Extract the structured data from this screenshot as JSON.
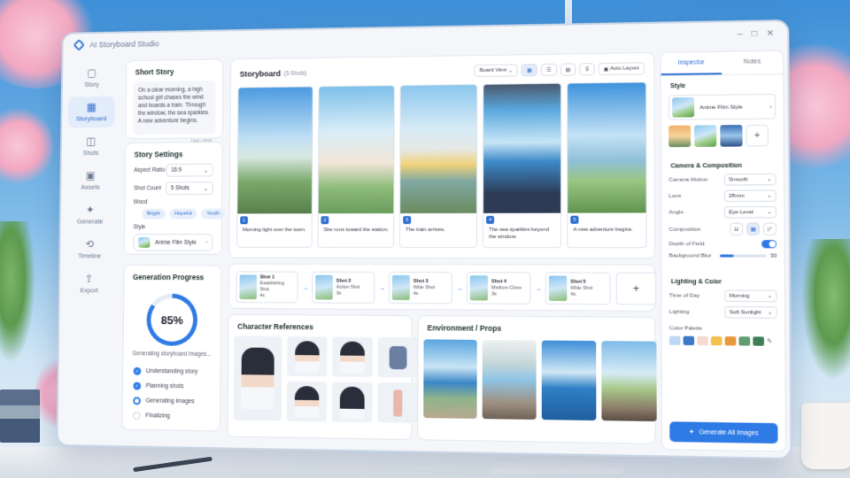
{
  "app": {
    "title": "AI Storyboard Studio"
  },
  "sidebar": {
    "items": [
      {
        "label": "Story",
        "icon": "book-icon"
      },
      {
        "label": "Storyboard",
        "icon": "grid-icon",
        "active": true
      },
      {
        "label": "Shots",
        "icon": "camera-icon"
      },
      {
        "label": "Assets",
        "icon": "image-icon"
      },
      {
        "label": "Generate",
        "icon": "sparkle-icon"
      },
      {
        "label": "Timeline",
        "icon": "timeline-icon"
      },
      {
        "label": "Export",
        "icon": "export-icon"
      }
    ]
  },
  "short_story": {
    "title": "Short Story",
    "text": "On a clear morning, a high school girl chases the wind and boards a train. Through the window, the sea sparkles. A new adventure begins.",
    "count": "184 / 500"
  },
  "settings": {
    "title": "Story Settings",
    "aspect_label": "Aspect Ratio",
    "aspect_value": "16:9",
    "shots_label": "Shot Count",
    "shots_value": "5 Shots",
    "mood_label": "Mood",
    "moods": [
      "Bright",
      "Hopeful",
      "Youth"
    ],
    "style_label": "Style",
    "style_value": "Anime Film Style"
  },
  "progress": {
    "title": "Generation Progress",
    "percent": 85,
    "percent_text": "85%",
    "status": "Generating storyboard images...",
    "steps": [
      {
        "label": "Understanding story",
        "state": "done"
      },
      {
        "label": "Planning shots",
        "state": "done"
      },
      {
        "label": "Generating images",
        "state": "active"
      },
      {
        "label": "Finalizing",
        "state": "todo"
      }
    ]
  },
  "storyboard": {
    "title": "Storyboard",
    "count": "(5 Shots)",
    "view": "Board View",
    "auto_layout": "Auto Layout",
    "frames": [
      {
        "num": "1",
        "caption": "Morning light over the town."
      },
      {
        "num": "2",
        "caption": "She runs toward the station."
      },
      {
        "num": "3",
        "caption": "The train arrives."
      },
      {
        "num": "4",
        "caption": "The sea sparkles beyond the window."
      },
      {
        "num": "5",
        "caption": "A new adventure begins."
      }
    ]
  },
  "shots": [
    {
      "name": "Shot 1",
      "type": "Establishing Shot",
      "dur": "4s"
    },
    {
      "name": "Shot 2",
      "type": "Action Shot",
      "dur": "3s"
    },
    {
      "name": "Shot 3",
      "type": "Wide Shot",
      "dur": "4s"
    },
    {
      "name": "Shot 4",
      "type": "Medium Close",
      "dur": "3s"
    },
    {
      "name": "Shot 5",
      "type": "Wide Shot",
      "dur": "4s"
    }
  ],
  "characters": {
    "title": "Character References"
  },
  "environment": {
    "title": "Environment / Props"
  },
  "inspector": {
    "tabs": [
      "Inspector",
      "Notes"
    ],
    "style_title": "Style",
    "style_value": "Anime Film Style",
    "camera_title": "Camera & Composition",
    "camera_motion_label": "Camera Motion",
    "camera_motion": "Smooth",
    "lens_label": "Lens",
    "lens": "28mm",
    "angle_label": "Angle",
    "angle": "Eye Level",
    "composition_label": "Composition",
    "dof_label": "Depth of Field",
    "blur_label": "Background Blur",
    "blur_value": "30",
    "blur_level": 30,
    "lighting_title": "Lighting & Color",
    "tod_label": "Time of Day",
    "tod": "Morning",
    "lighting_label": "Lighting",
    "lighting": "Soft Sunlight",
    "palette_label": "Color Palette",
    "palette": [
      "#bcd8f2",
      "#3b78c8",
      "#f3d9cf",
      "#f2c14e",
      "#e79a3c",
      "#5f9e6e",
      "#3f7e55"
    ],
    "generate_label": "Generate All Images"
  }
}
